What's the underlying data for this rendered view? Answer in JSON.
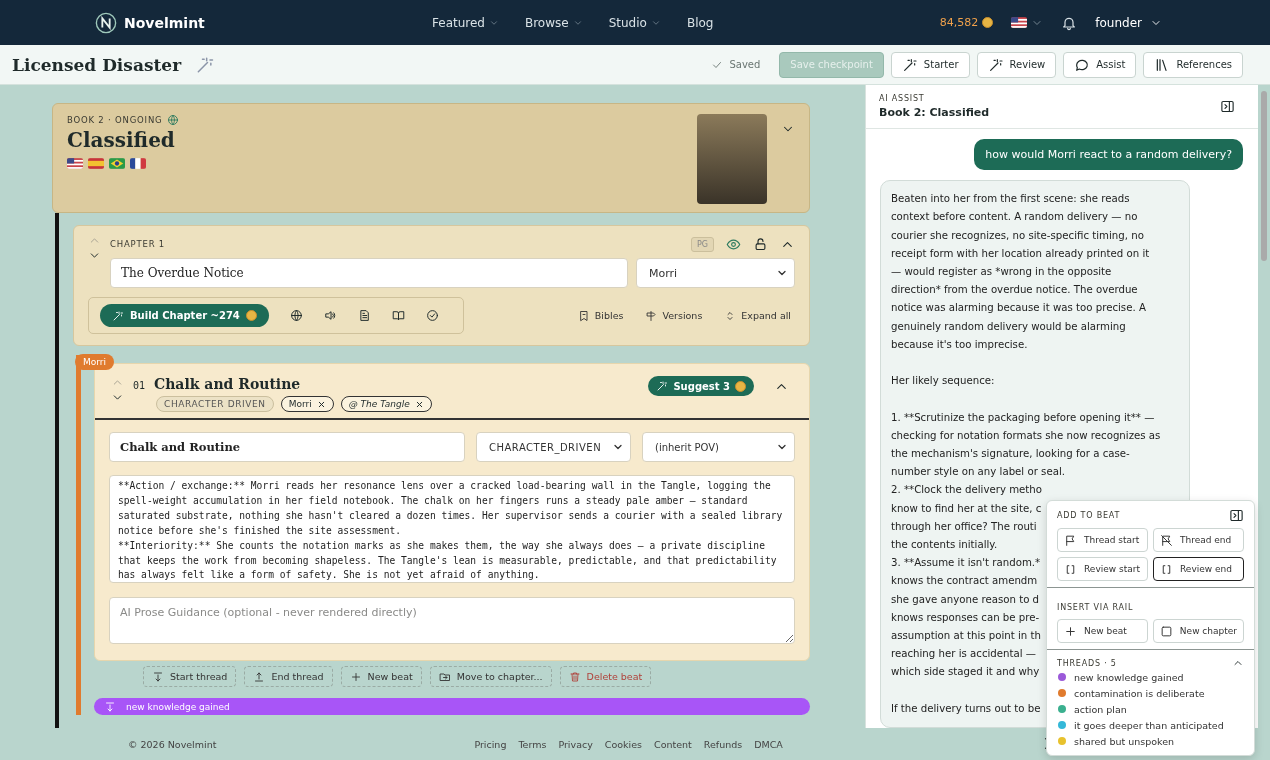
{
  "nav": {
    "brand": "Novelmint",
    "links": [
      {
        "label": "Featured",
        "dropdown": true
      },
      {
        "label": "Browse",
        "dropdown": true
      },
      {
        "label": "Studio",
        "dropdown": true
      },
      {
        "label": "Blog",
        "dropdown": false
      }
    ],
    "coins": "84,582",
    "user": "founder"
  },
  "toolbar": {
    "title": "Licensed Disaster",
    "status": "Saved",
    "buttons": [
      {
        "label": "Save checkpoint",
        "kind": "primary",
        "disabled": true
      },
      {
        "label": "Starter",
        "kind": "wand",
        "disabled": false
      },
      {
        "label": "Review",
        "kind": "wand",
        "disabled": false
      },
      {
        "label": "Assist",
        "kind": "chat",
        "disabled": false
      },
      {
        "label": "References",
        "kind": "books",
        "disabled": false
      }
    ]
  },
  "book": {
    "meta": "BOOK 2 · ONGOING",
    "title": "Classified",
    "expanded": false
  },
  "chapter": {
    "label": "CHAPTER 1",
    "rating": "PG",
    "title": "The Overdue Notice",
    "pov": "Morri",
    "expanded": true,
    "build": {
      "label": "Build Chapter",
      "cost": "~274"
    },
    "links": [
      {
        "label": "Bibles",
        "kind": "bookmark"
      },
      {
        "label": "Versions",
        "kind": "signpost"
      },
      {
        "label": "Expand all",
        "kind": "updown"
      }
    ]
  },
  "beat": {
    "tag": "Morri",
    "number": "01",
    "title": "Chalk and Routine",
    "expanded": true,
    "suggest": {
      "label": "Suggest",
      "count": "3"
    },
    "chips": [
      {
        "kind": "type",
        "label": "CHARACTER DRIVEN"
      },
      {
        "kind": "character",
        "label": "Morri"
      },
      {
        "kind": "location",
        "label": "@ The Tangle"
      }
    ],
    "title_value": "Chalk and Routine",
    "type_value": "CHARACTER_DRIVEN",
    "pov_value": "(inherit POV)",
    "text": "**Action / exchange:** Morri reads her resonance lens over a cracked load-bearing wall in the Tangle, logging the spell-weight accumulation in her field notebook. The chalk on her fingers runs a steady pale amber — standard saturated substrate, nothing she hasn't cleared a dozen times. Her supervisor sends a courier with a sealed library notice before she's finished the site assessment.\n**Interiority:** She counts the notation marks as she makes them, the way she always does — a private discipline that keeps the work from becoming shapeless. The Tangle's lean is measurable, predictable, and that predictability has always felt like a form of safety. She is not yet afraid of anything.",
    "guidance_placeholder": "AI Prose Guidance (optional - never rendered directly)",
    "actions": [
      {
        "label": "Start thread",
        "kind": "start"
      },
      {
        "label": "End thread",
        "kind": "end"
      },
      {
        "label": "New beat",
        "kind": "plus"
      },
      {
        "label": "Move to chapter...",
        "kind": "move"
      },
      {
        "label": "Delete beat",
        "kind": "delete"
      }
    ]
  },
  "thread_bar": {
    "label": "new knowledge gained",
    "color": "#a855f7"
  },
  "assist": {
    "label": "AI ASSIST",
    "title": "Book 2: Classified",
    "user_message": "how would Morri react to a random delivery?",
    "reply_blocks": [
      [
        "Beaten into her from the first scene: she reads",
        "context before content. A random delivery — no",
        "courier she recognizes, no site-specific timing, no",
        "receipt form with her location already printed on it",
        "— would register as *wrong in the opposite",
        "direction* from the overdue notice. The overdue",
        "notice was alarming because it was too precise. A",
        "genuinely random delivery would be alarming",
        "because it's too imprecise."
      ],
      [
        "Her likely sequence:"
      ],
      [
        "1. **Scrutinize the packaging before opening it** —",
        "checking for notation formats she now recognizes as",
        "the mechanism's signature, looking for a case-",
        "number style on any label or seal.",
        "2. **Clock the delivery metho",
        "know to find her at the site, c",
        "through her office? The routi",
        "the contents initially.",
        "3. **Assume it isn't random.*",
        "knows the contract amendm",
        "she gave anyone reason to d",
        "knows responses can be pre-",
        "assumption at this point in th",
        "reaching her is accidental —",
        "which side staged it and why"
      ],
      [
        "If the delivery turns out to be"
      ]
    ]
  },
  "popup": {
    "add_heading": "ADD TO BEAT",
    "add_buttons": [
      {
        "label": "Thread start",
        "kind": "flag",
        "selected": false
      },
      {
        "label": "Thread end",
        "kind": "flag-off",
        "selected": false
      },
      {
        "label": "Review start",
        "kind": "bracket",
        "selected": false
      },
      {
        "label": "Review end",
        "kind": "bracket",
        "selected": true
      }
    ],
    "insert_heading": "INSERT VIA RAIL",
    "insert_buttons": [
      {
        "label": "New beat",
        "kind": "plus"
      },
      {
        "label": "New chapter",
        "kind": "square"
      }
    ],
    "threads_heading": "THREADS · 5",
    "threads_expanded": true,
    "threads": [
      {
        "label": "new knowledge gained",
        "color": "#9b59d9"
      },
      {
        "label": "contamination is deliberate",
        "color": "#e07b2e"
      },
      {
        "label": "action plan",
        "color": "#3bb08f"
      },
      {
        "label": "it goes deeper than anticipated",
        "color": "#35b8d8"
      },
      {
        "label": "shared but unspoken",
        "color": "#e8c22e"
      }
    ]
  },
  "footer": {
    "copyright": "© 2026 Novelmint",
    "links": [
      "Pricing",
      "Terms",
      "Privacy",
      "Cookies",
      "Content",
      "Refunds",
      "DMCA"
    ]
  }
}
